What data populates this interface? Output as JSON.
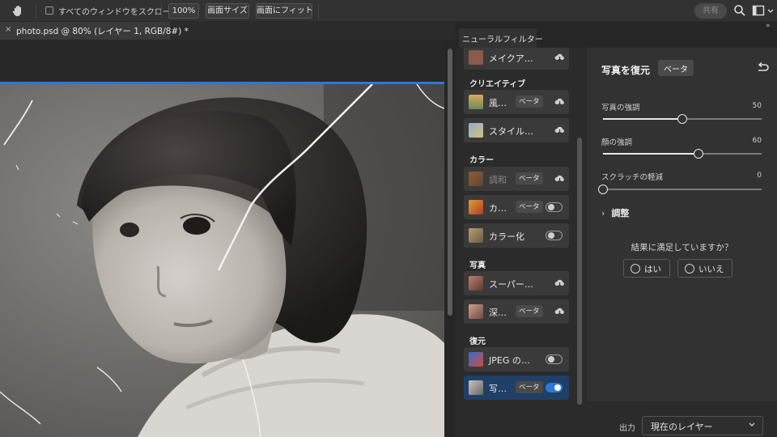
{
  "options_bar": {
    "scroll_all_label": "すべてのウィンドウをスクロール",
    "zoom_100_label": "100%",
    "fit_screen_size_label": "画面サイズ",
    "fit_screen_label": "画面にフィット",
    "share_label": "共有"
  },
  "document": {
    "tab_close": "×",
    "tab_title": "photo.psd @ 80% (レイヤー 1, RGB/8#) *"
  },
  "panel": {
    "tab_label": "ニューラルフィルター",
    "expand_glyph": "»"
  },
  "filter_list": {
    "categories": {
      "creative": "クリエイティブ",
      "color": "カラー",
      "photo": "写真",
      "restore": "復元"
    },
    "items": [
      {
        "name": "メイクア…"
      },
      {
        "name": "風…",
        "badge": "ベータ"
      },
      {
        "name": "スタイル…"
      },
      {
        "name": "調和",
        "badge": "ベータ"
      },
      {
        "name": "カ…",
        "badge": "ベータ",
        "toggle": false
      },
      {
        "name": "カラー化",
        "toggle": false
      },
      {
        "name": "スーパー…"
      },
      {
        "name": "深…",
        "badge": "ベータ"
      },
      {
        "name": "JPEG の…",
        "toggle": false
      },
      {
        "name": "写…",
        "badge": "ベータ",
        "toggle": true
      }
    ]
  },
  "settings": {
    "title": "写真を復元",
    "badge": "ベータ",
    "sliders": [
      {
        "label": "写真の強調",
        "value": 50,
        "display": "50"
      },
      {
        "label": "顔の強調",
        "value": 60,
        "display": "60"
      },
      {
        "label": "スクラッチの軽減",
        "value": 0,
        "display": "0"
      }
    ],
    "adjust_label": "調整",
    "feedback_question": "結果に満足していますか？",
    "yes_label": "はい",
    "no_label": "いいえ"
  },
  "output": {
    "label": "出力",
    "selected": "現在のレイヤー"
  },
  "colors": {
    "accent": "#2d78d8",
    "panel_bg": "#323232",
    "list_bg": "#2b2b2b"
  }
}
